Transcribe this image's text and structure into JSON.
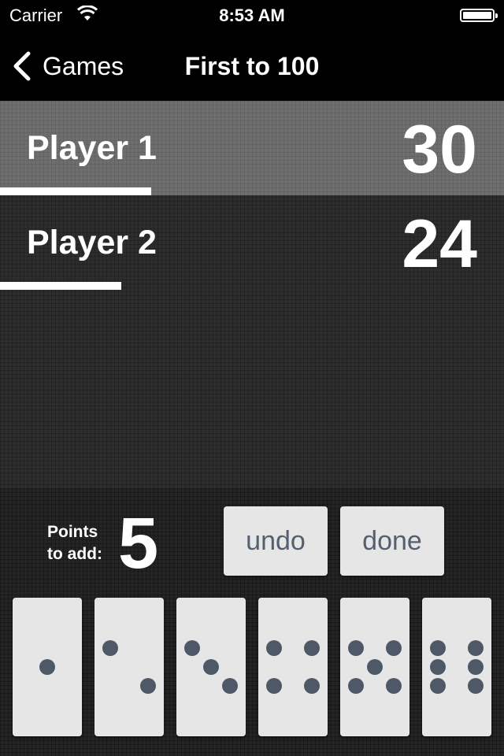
{
  "status_bar": {
    "carrier": "Carrier",
    "time": "8:53 AM"
  },
  "nav": {
    "back_label": "Games",
    "title": "First to 100"
  },
  "target_score": 100,
  "players": [
    {
      "name": "Player 1",
      "score": "30",
      "active": true
    },
    {
      "name": "Player 2",
      "score": "24",
      "active": false
    }
  ],
  "controls": {
    "points_label_line1": "Points",
    "points_label_line2": "to add:",
    "points_value": "5",
    "undo_label": "undo",
    "done_label": "done"
  },
  "dominoes": [
    1,
    2,
    3,
    4,
    5,
    6
  ],
  "colors": {
    "pip": "#4f5866",
    "button_text": "#55606f",
    "active_row": "#6e6e6e"
  }
}
